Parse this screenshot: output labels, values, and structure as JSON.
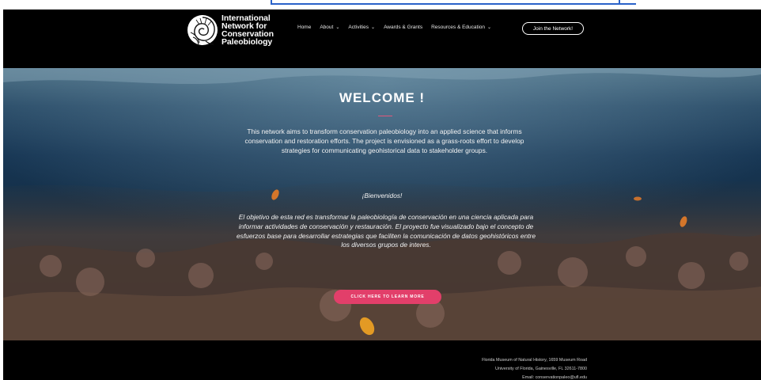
{
  "header": {
    "logo_lines": [
      "International",
      "Network for",
      "Conservation",
      "Paleobiology"
    ],
    "nav": [
      {
        "label": "Home",
        "dropdown": false
      },
      {
        "label": "About",
        "dropdown": true
      },
      {
        "label": "Activities",
        "dropdown": true
      },
      {
        "label": "Awards & Grants",
        "dropdown": false
      },
      {
        "label": "Resources & Education",
        "dropdown": true
      }
    ],
    "join_label": "Join the Network!",
    "chevron": "⌄"
  },
  "hero": {
    "title": "WELCOME !",
    "intro": "This network aims to transform conservation paleobiology into an applied science that informs conservation and restoration efforts. The project is envisioned as a grass-roots effort to develop strategies for communicating geohistorical data to stakeholder groups.",
    "bienvenidos": "¡Bienvenidos!",
    "spanish": "El objetivo de esta red es transformar la paleobiología de conservación en una ciencia aplicada para informar actividades de conservación y restauración. El proyecto fue visualizado bajo el concepto de esfuerzos base para desarrollar estrategias que faciliten la comunicación de datos geohistóricos entre los diversos grupos de interes.",
    "cta_label": "CLICK HERE TO LEARN MORE"
  },
  "footer": {
    "line1": "Florida Museum of Natural History, 1659 Museum Road",
    "line2": "University of Florida, Gainesville, FL 32611-7800",
    "line3": "Email: conservationpaleo@ufl.edu"
  },
  "colors": {
    "accent": "#e23f6a",
    "link_bar": "#2a62c9",
    "header_bg": "#000000"
  }
}
